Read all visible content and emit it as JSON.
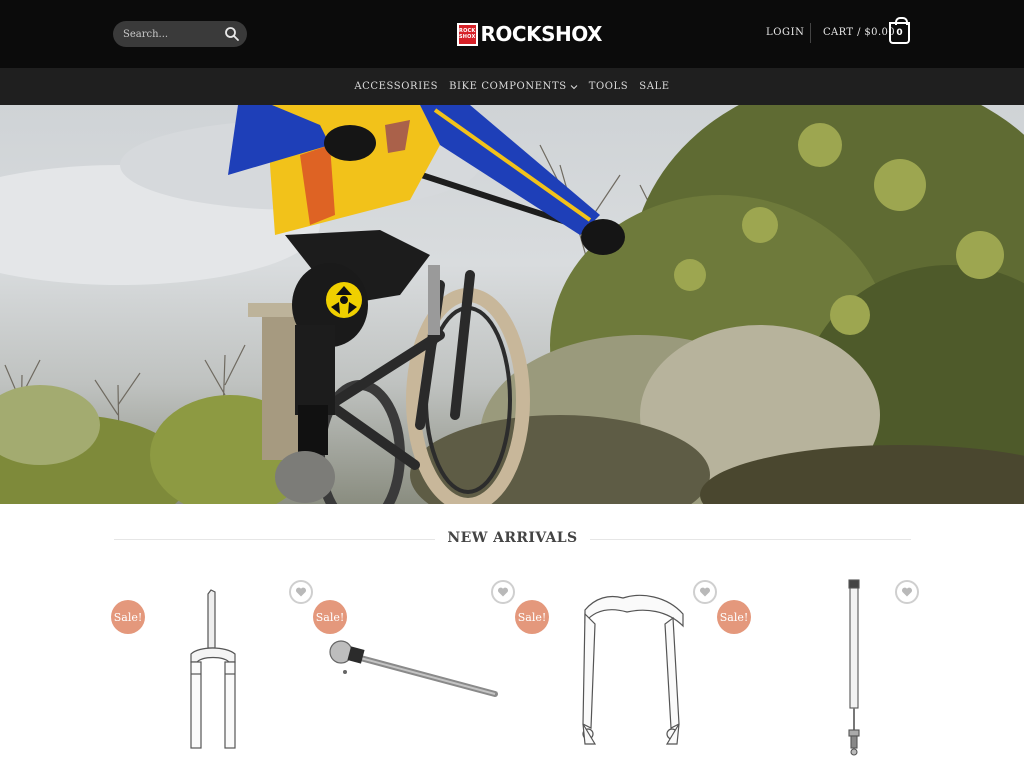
{
  "header": {
    "search_placeholder": "Search...",
    "logo_badge_top": "ROCK",
    "logo_badge_bottom": "SHOX",
    "logo_text": "ROCKSHOX",
    "login_label": "LOGIN",
    "cart_label": "CART / $0.00",
    "cart_count": "0"
  },
  "nav": {
    "items": [
      {
        "label": "ACCESSORIES"
      },
      {
        "label": "BIKE COMPONENTS"
      },
      {
        "label": "TOOLS"
      },
      {
        "label": "SALE"
      }
    ]
  },
  "section": {
    "title": "NEW ARRIVALS"
  },
  "products": [
    {
      "badge": "Sale!",
      "image": "suspension-fork-crown"
    },
    {
      "badge": "Sale!",
      "image": "thru-axle"
    },
    {
      "badge": "Sale!",
      "image": "lower-legs"
    },
    {
      "badge": "Sale!",
      "image": "damper-shaft"
    }
  ],
  "icons": {
    "search": "search-icon",
    "wishlist": "heart-icon",
    "dropdown": "chevron-down-icon"
  },
  "colors": {
    "header_bg": "#0b0b0b",
    "nav_bg": "#1f1f1f",
    "sale_badge": "#e4987c",
    "logo_red": "#d62027"
  }
}
